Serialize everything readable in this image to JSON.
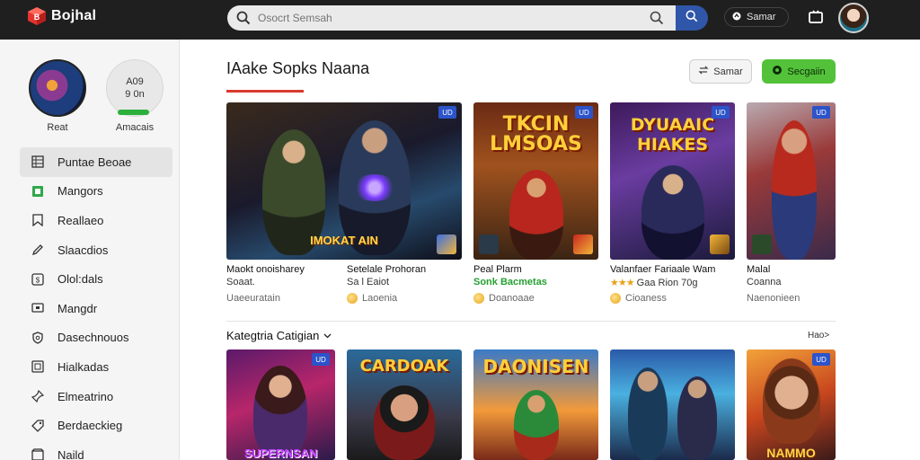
{
  "header": {
    "logo_text": "Bojhal",
    "search_placeholder": "Osocrt Semsah",
    "user_label": "Samar"
  },
  "sidebar": {
    "profile1_label": "Reat",
    "profile2_text_line1": "A09",
    "profile2_text_line2": "9 0n",
    "profile2_progress": 0.8,
    "profile2_label": "Amacais",
    "items": [
      {
        "label": "Puntae Beoae",
        "icon": "grid-icon",
        "active": true
      },
      {
        "label": "Mangors",
        "icon": "green-square-icon"
      },
      {
        "label": "Reallaeo",
        "icon": "bookmark-icon"
      },
      {
        "label": "Slaacdios",
        "icon": "pen-icon"
      },
      {
        "label": "Olol:dals",
        "icon": "dollar-box-icon"
      },
      {
        "label": "Mangdr",
        "icon": "monitor-icon"
      },
      {
        "label": "Dasechnouos",
        "icon": "shield-icon"
      },
      {
        "label": "Hialkadas",
        "icon": "image-box-icon"
      },
      {
        "label": "Elmeatrino",
        "icon": "pin-icon"
      },
      {
        "label": "Berdaeckieg",
        "icon": "tag-icon"
      },
      {
        "label": "Naild",
        "icon": "box-icon"
      }
    ]
  },
  "main": {
    "title": "IAake Sopks  Naana",
    "save_label": "Samar",
    "primary_label": "Secgaiin",
    "featured": [
      {
        "title": "Maokt onoisharey",
        "sub": "Soaat.",
        "foot": "Uaeeuratain",
        "thumb_caption": "IMOKAT AIN",
        "badge": "UD"
      },
      {
        "title": "Setelale Prohoran",
        "sub": "Sa l Eaiot",
        "foot": "Laoenia",
        "badge": "UD"
      },
      {
        "title": "Peal Plarm",
        "sub": "Sonk Bacmetas",
        "foot": "Doanoaae",
        "thumb_heading": "TKCIN LMSOAS",
        "badge": "UD"
      },
      {
        "title": "Valanfaer Fariaale Wam",
        "sub": "Gaa Rion 70g",
        "foot": "Cioaness",
        "thumb_heading": "DYUAAIC HIAKES",
        "badge": "UD"
      },
      {
        "title": "Malal",
        "sub": "Coanna",
        "foot": "Naenonieen",
        "badge": "UD"
      }
    ],
    "section_title": "Kategtria Catigian",
    "see_more": "Hao>",
    "category_cards": [
      {
        "thumb_caption": "SUPERNSAN",
        "badge": "UD"
      },
      {
        "thumb_heading": "CARDOAK",
        "badge": ""
      },
      {
        "thumb_heading": "DAONISEN",
        "badge": ""
      },
      {
        "badge": ""
      },
      {
        "thumb_caption": "NAMMO",
        "badge": "UD"
      }
    ]
  }
}
